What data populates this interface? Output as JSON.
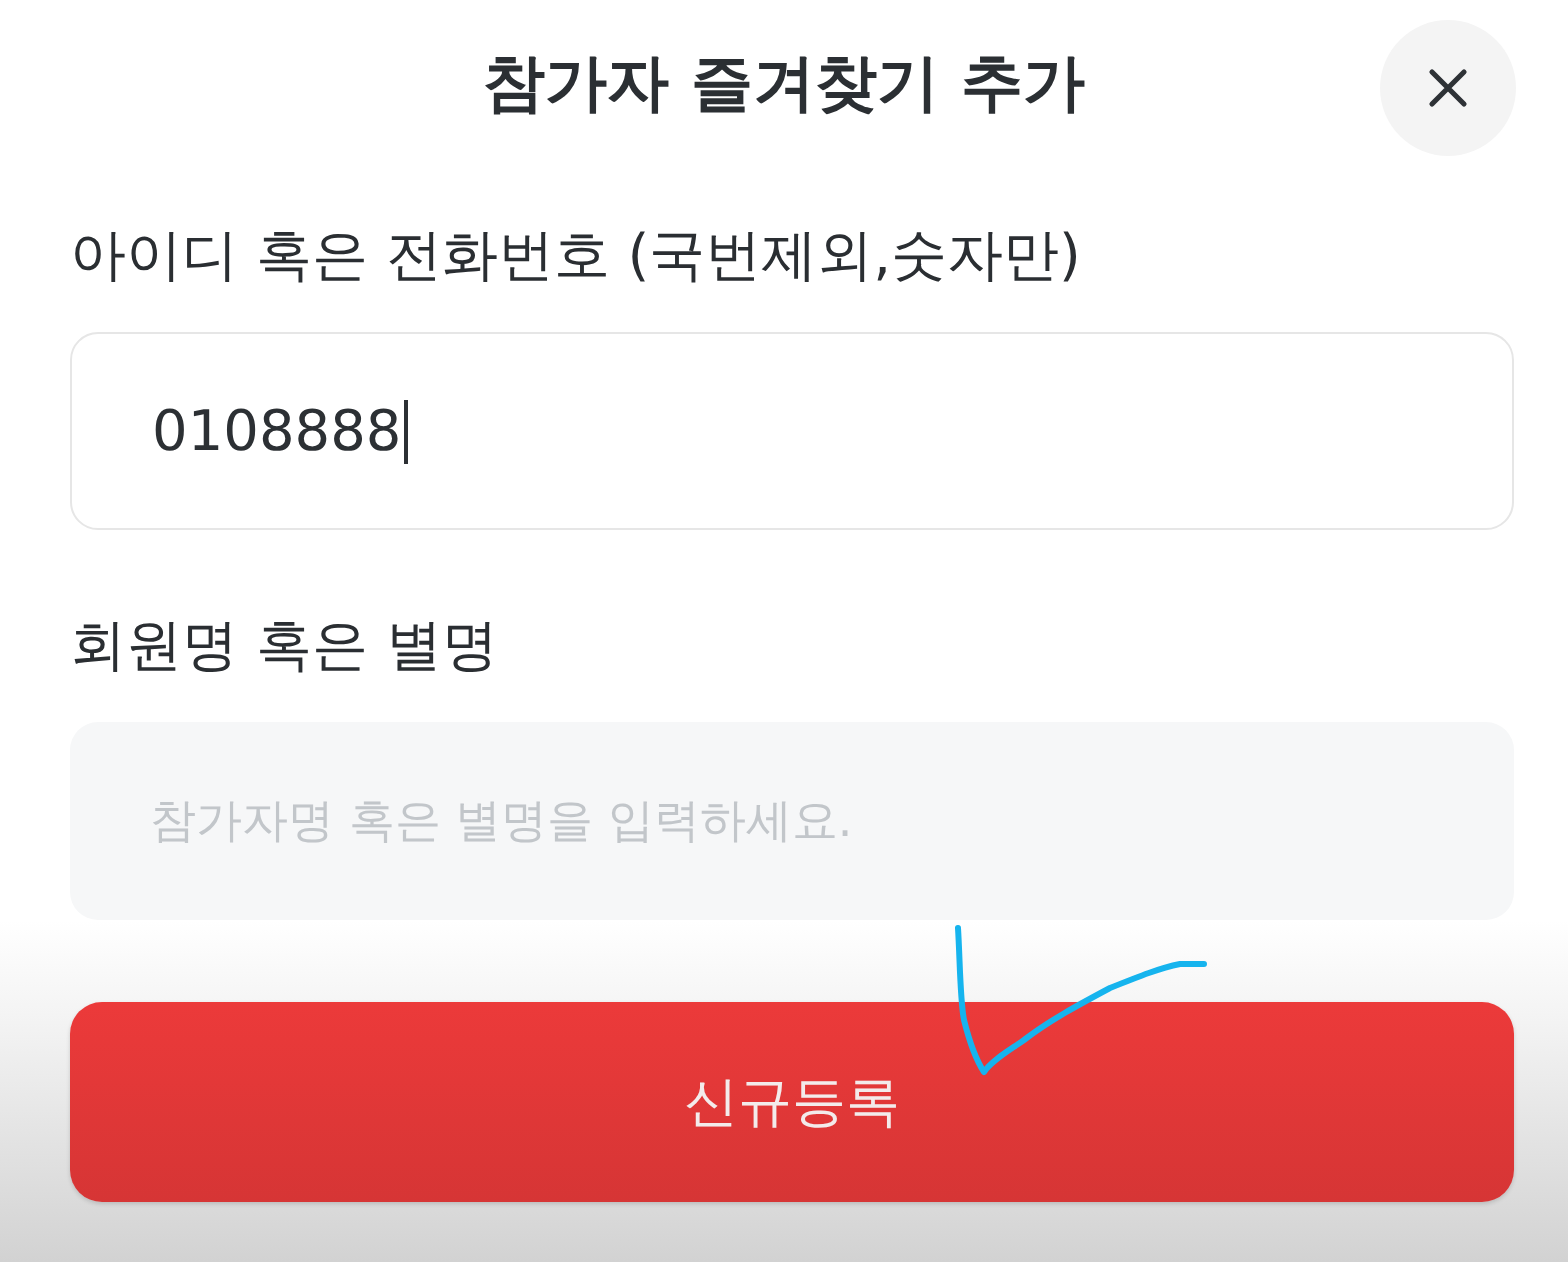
{
  "dialog": {
    "title": "참가자 즐겨찾기 추가"
  },
  "fields": [
    {
      "label": "아이디 혹은 전화번호 (국번제외,숫자만)",
      "value": "0108888",
      "focused": true
    },
    {
      "label": "회원명 혹은 별명",
      "placeholder": "참가자명 혹은 별명을 입력하세요.",
      "focused": false
    }
  ],
  "submit_button": {
    "label": "신규등록"
  }
}
